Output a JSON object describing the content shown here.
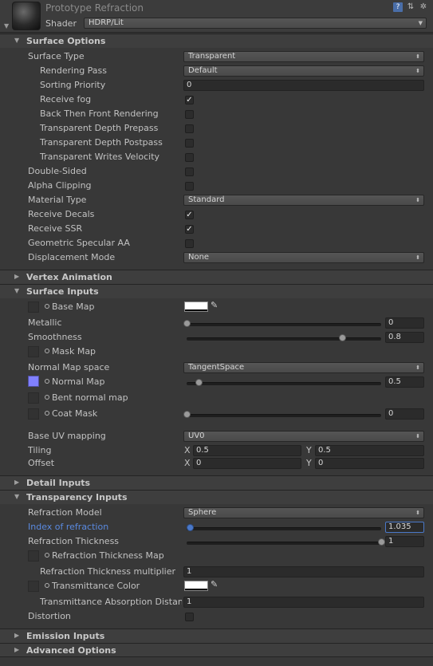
{
  "header": {
    "title": "Prototype Refraction",
    "shader_label": "Shader",
    "shader_value": "HDRP/Lit",
    "icons": [
      "help-book-icon",
      "preset-icon",
      "settings-gear-icon"
    ]
  },
  "sections": {
    "surface_options": "Surface Options",
    "vertex_animation": "Vertex Animation",
    "surface_inputs": "Surface Inputs",
    "detail_inputs": "Detail Inputs",
    "transparency_inputs": "Transparency Inputs",
    "emission_inputs": "Emission Inputs",
    "advanced_options": "Advanced Options"
  },
  "surface_options": {
    "surface_type": {
      "label": "Surface Type",
      "value": "Transparent"
    },
    "rendering_pass": {
      "label": "Rendering Pass",
      "value": "Default"
    },
    "sorting_priority": {
      "label": "Sorting Priority",
      "value": "0"
    },
    "receive_fog": {
      "label": "Receive fog",
      "checked": true
    },
    "back_then_front": {
      "label": "Back Then Front Rendering",
      "checked": false
    },
    "depth_prepass": {
      "label": "Transparent Depth Prepass",
      "checked": false
    },
    "depth_postpass": {
      "label": "Transparent Depth Postpass",
      "checked": false
    },
    "writes_velocity": {
      "label": "Transparent Writes Velocity",
      "checked": false
    },
    "double_sided": {
      "label": "Double-Sided",
      "checked": false
    },
    "alpha_clipping": {
      "label": "Alpha Clipping",
      "checked": false
    },
    "material_type": {
      "label": "Material Type",
      "value": "Standard"
    },
    "receive_decals": {
      "label": "Receive Decals",
      "checked": true
    },
    "receive_ssr": {
      "label": "Receive SSR",
      "checked": true
    },
    "geometric_specular_aa": {
      "label": "Geometric Specular AA",
      "checked": false
    },
    "displacement_mode": {
      "label": "Displacement Mode",
      "value": "None"
    }
  },
  "surface_inputs": {
    "base_map": {
      "label": "Base Map",
      "color": "#ffffff"
    },
    "metallic": {
      "label": "Metallic",
      "value": "0",
      "fraction": 0
    },
    "smoothness": {
      "label": "Smoothness",
      "value": "0.8",
      "fraction": 0.8
    },
    "mask_map": {
      "label": "Mask Map"
    },
    "normal_map_space": {
      "label": "Normal Map space",
      "value": "TangentSpace"
    },
    "normal_map": {
      "label": "Normal Map",
      "value": "0.5",
      "fraction": 0.0625,
      "slot_color": "#8080ff"
    },
    "bent_normal_map": {
      "label": "Bent normal map"
    },
    "coat_mask": {
      "label": "Coat Mask",
      "value": "0",
      "fraction": 0
    },
    "base_uv_mapping": {
      "label": "Base UV mapping",
      "value": "UV0"
    },
    "tiling": {
      "label": "Tiling",
      "x": "0.5",
      "y": "0.5"
    },
    "offset": {
      "label": "Offset",
      "x": "0",
      "y": "0"
    },
    "axis_x": "X",
    "axis_y": "Y"
  },
  "transparency_inputs": {
    "refraction_model": {
      "label": "Refraction Model",
      "value": "Sphere"
    },
    "index_of_refraction": {
      "label": "Index of refraction",
      "value": "1.035",
      "fraction": 0.0175
    },
    "refraction_thickness": {
      "label": "Refraction Thickness",
      "value": "1",
      "fraction": 1
    },
    "refraction_thickness_map": {
      "label": "Refraction Thickness Map"
    },
    "thickness_multiplier": {
      "label": "Refraction Thickness multiplier",
      "value": "1"
    },
    "transmittance_color": {
      "label": "Transmittance Color",
      "color": "#ffffff"
    },
    "absorption_distance": {
      "label": "Transmittance Absorption Distance",
      "value": "1"
    },
    "distortion": {
      "label": "Distortion",
      "checked": false
    }
  },
  "colors": {
    "background": "#383838",
    "accent_blue": "#4a78c8",
    "highlight_label": "#5a8ae0"
  }
}
